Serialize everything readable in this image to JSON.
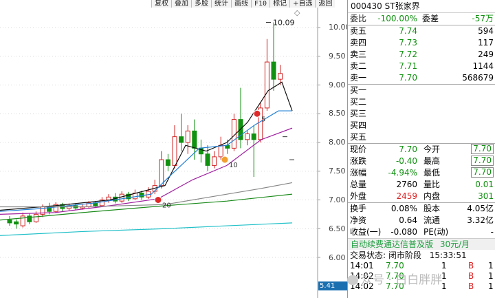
{
  "toolbar": [
    "复权",
    "叠加",
    "多股",
    "统计",
    "画线",
    "F10",
    "标记",
    "+自选",
    "返回"
  ],
  "price_axis": [
    "10.00",
    "9.50",
    "9.00",
    "8.50",
    "8.00",
    "7.50",
    "7.00",
    "6.50",
    "6.00"
  ],
  "annotations": {
    "high": "10.09",
    "marker1": "5",
    "marker2": "10",
    "marker3": "20"
  },
  "current_tag": "5.41",
  "colors": {
    "up": "#d22222",
    "down": "#109110",
    "ma5": "#111111",
    "ma10": "#1f7fd6",
    "ma20": "#a020a0",
    "ma60": "#888888",
    "ma120": "#1a8a1a",
    "ma250": "#20c0c8"
  },
  "header": {
    "code_name": "000430 ST张家界"
  },
  "weibi": {
    "label": "委比",
    "value": "-100.00%",
    "label2": "委差",
    "value2": "-57万"
  },
  "asks": [
    {
      "label": "卖五",
      "price": "7.74",
      "vol": "594"
    },
    {
      "label": "卖四",
      "price": "7.73",
      "vol": "117"
    },
    {
      "label": "卖三",
      "price": "7.72",
      "vol": "249"
    },
    {
      "label": "卖二",
      "price": "7.71",
      "vol": "1144"
    },
    {
      "label": "卖一",
      "price": "7.70",
      "vol": "568679"
    }
  ],
  "bids": [
    {
      "label": "买一"
    },
    {
      "label": "买二"
    },
    {
      "label": "买三"
    },
    {
      "label": "买四"
    },
    {
      "label": "买五"
    }
  ],
  "quote": [
    {
      "l1": "现价",
      "v1": "7.70",
      "l2": "今开",
      "v2": "7.70"
    },
    {
      "l1": "涨跌",
      "v1": "-0.40",
      "l2": "最高",
      "v2": "7.70"
    },
    {
      "l1": "涨幅",
      "v1": "-4.94%",
      "l2": "最低",
      "v2": "7.70"
    },
    {
      "l1": "总量",
      "v1": "2760",
      "l2": "量比",
      "v2": "0.01"
    },
    {
      "l1": "外盘",
      "v1": "2459",
      "l2": "内盘",
      "v2": "301"
    }
  ],
  "stats": [
    {
      "l1": "换手",
      "v1": "0.08%",
      "l2": "股本",
      "v2": "4.05亿"
    },
    {
      "l1": "净资",
      "v1": "0.64",
      "l2": "流通",
      "v2": "3.32亿"
    },
    {
      "l1": "收益(一)",
      "v1": "-0.080",
      "l2": "PE(动)",
      "v2": "-"
    }
  ],
  "banner": {
    "text": "自动续费通达信普及版",
    "price": "30元/月"
  },
  "status": {
    "label": "交易状态: 闭市阶段",
    "time": "15:33:51"
  },
  "trades": [
    {
      "time": "14:01",
      "price": "7.70",
      "vol": "1",
      "side": "B",
      "extra": "1"
    },
    {
      "time": "14:02",
      "price": "7.70",
      "vol": "1",
      "side": "B",
      "extra": "1"
    },
    {
      "time": "14:02",
      "price": "7.70",
      "vol": "1",
      "side": "B",
      "extra": "1"
    }
  ],
  "watermark": "众号 · 白白胖胖"
}
